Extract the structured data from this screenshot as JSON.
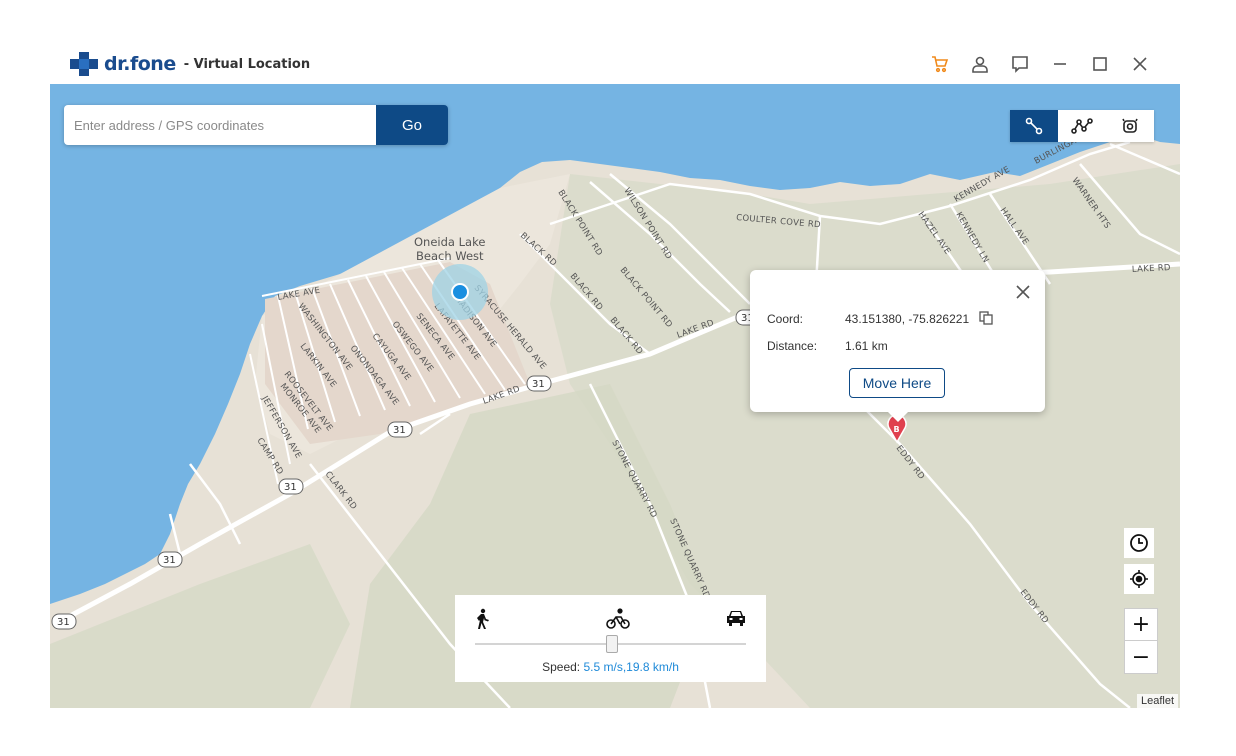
{
  "app": {
    "brand": "dr.fone",
    "subtitle": "- Virtual Location"
  },
  "search": {
    "placeholder": "Enter address / GPS coordinates",
    "go_label": "Go"
  },
  "popup": {
    "coord_label": "Coord:",
    "coord_value": "43.151380, -75.826221",
    "distance_label": "Distance:",
    "distance_value": "1.61 km",
    "move_label": "Move Here",
    "marker_letter": "B"
  },
  "speed": {
    "label": "Speed:",
    "value": "5.5 m/s,19.8 km/h",
    "level": 0.5
  },
  "map": {
    "place": [
      "Oneida Lake",
      "Beach West"
    ],
    "attribution": "Leaflet",
    "route_shield": "31",
    "roads": {
      "lake_ave": "LAKE AVE",
      "washington_ave": "WASHINGTON AVE",
      "larkin_ave": "LARKIN AVE",
      "roosevelt_ave": "ROOSEVELT AVE",
      "monroe_ave": "MONROE AVE",
      "jefferson_ave": "JEFFERSON AVE",
      "camp_rd": "CAMP RD",
      "clark_rd": "CLARK RD",
      "onondaga_ave": "ONONDAGA AVE",
      "cayuga_ave": "CAYUGA AVE",
      "oswego_ave": "OSWEGO AVE",
      "seneca_ave": "SENECA AVE",
      "lafayette_ave": "LAFAYETTE AVE",
      "madison_ave": "MADISON AVE",
      "syracuse_herald_ave": "SYRACUSE HERALD AVE",
      "black_rd": "BLACK RD",
      "black_point_rd": "BLACK POINT RD",
      "wilson_point_rd": "WILSON POINT RD",
      "coulter_cove_rd": "COULTER COVE RD",
      "hazel_ave": "HAZEL AVE",
      "kennedy_ln": "KENNEDY LN",
      "kennedy_ave": "KENNEDY AVE",
      "hall_ave": "HALL AVE",
      "warner_hts": "WARNER HTS",
      "burlingame": "BURLINGAME",
      "lake_rd": "LAKE RD",
      "stone_quarry_rd": "STONE QUARRY RD",
      "eddy_rd": "EDDY RD"
    }
  },
  "colors": {
    "accent": "#0e4a86",
    "water": "#75b4e3",
    "speed_value": "#1f8ad8",
    "marker": "#e0414f"
  }
}
